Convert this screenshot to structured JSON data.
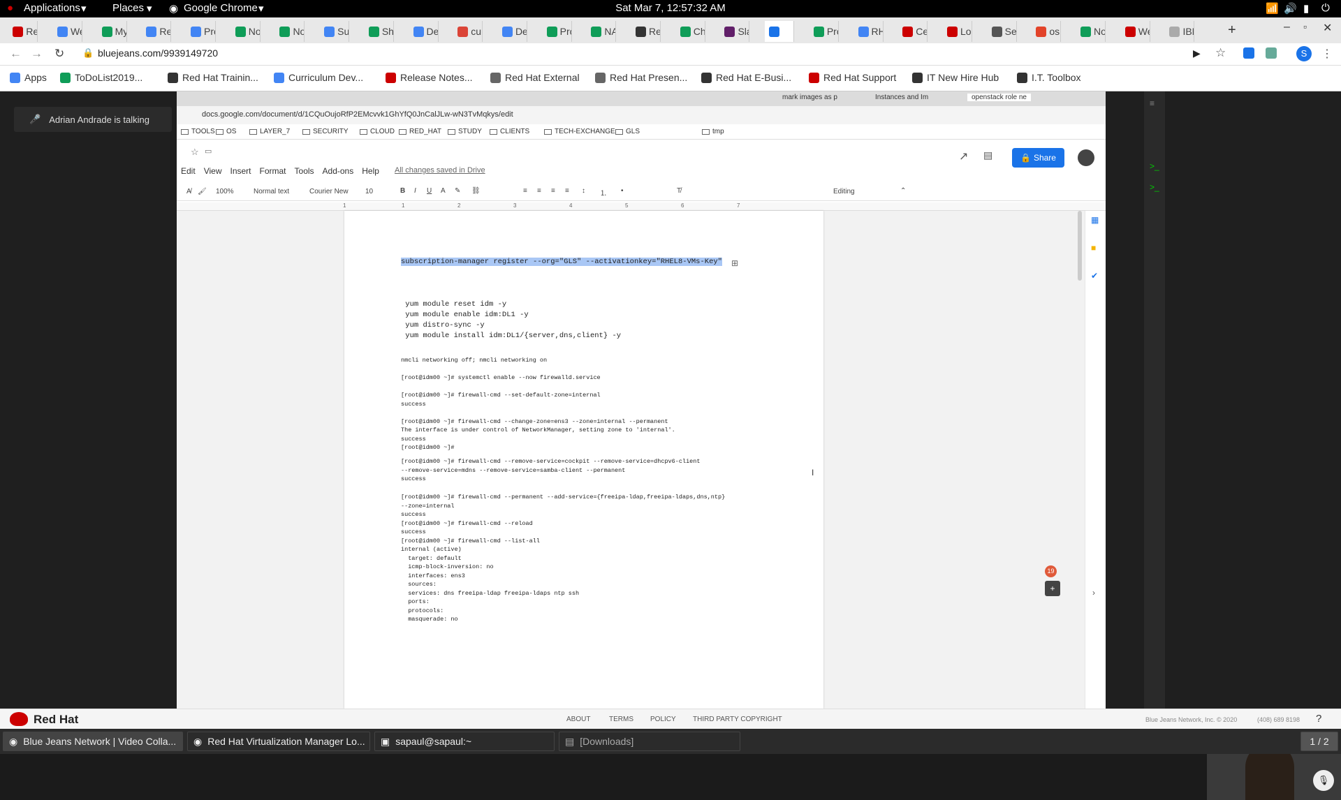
{
  "topbar": {
    "applications": "Applications",
    "places": "Places",
    "app": "Google Chrome",
    "clock": "Sat Mar  7, 12:57:32 AM"
  },
  "chrome": {
    "tabs": [
      {
        "label": "Red",
        "color": "#cc0000"
      },
      {
        "label": "We",
        "color": "#4285f4"
      },
      {
        "label": "My",
        "color": "#0f9d58"
      },
      {
        "label": "Red",
        "color": "#4285f4"
      },
      {
        "label": "Proj",
        "color": "#4285f4"
      },
      {
        "label": "Nov",
        "color": "#0f9d58"
      },
      {
        "label": "Nov",
        "color": "#0f9d58"
      },
      {
        "label": "Sup",
        "color": "#4285f4"
      },
      {
        "label": "Sha",
        "color": "#0f9d58"
      },
      {
        "label": "Dep",
        "color": "#4285f4"
      },
      {
        "label": "curi",
        "color": "#db4437"
      },
      {
        "label": "Dep",
        "color": "#4285f4"
      },
      {
        "label": "Proj",
        "color": "#0f9d58"
      },
      {
        "label": "NA",
        "color": "#0f9d58"
      },
      {
        "label": "Red",
        "color": "#333333"
      },
      {
        "label": "Cha",
        "color": "#0f9d58"
      },
      {
        "label": "Slac",
        "color": "#611f69"
      },
      {
        "label": "",
        "color": "#1a73e8"
      },
      {
        "label": "Proj",
        "color": "#0f9d58"
      },
      {
        "label": "RH",
        "color": "#4285f4"
      },
      {
        "label": "Cep",
        "color": "#cc0000"
      },
      {
        "label": "Log",
        "color": "#cc0000"
      },
      {
        "label": "Sett",
        "color": "#555555"
      },
      {
        "label": "osp",
        "color": "#e24329"
      },
      {
        "label": "Nov",
        "color": "#0f9d58"
      },
      {
        "label": "We",
        "color": "#cc0000"
      },
      {
        "label": "IBM",
        "color": "#aaaaaa"
      }
    ],
    "url": "bluejeans.com/9939149720",
    "bookmarks": [
      {
        "label": "Apps"
      },
      {
        "label": "ToDoList2019..."
      },
      {
        "label": "Red Hat Trainin..."
      },
      {
        "label": "Curriculum Dev..."
      },
      {
        "label": "Release Notes..."
      },
      {
        "label": "Red Hat External"
      },
      {
        "label": "Red Hat Presen..."
      },
      {
        "label": "Red Hat E-Busi..."
      },
      {
        "label": "Red Hat Support"
      },
      {
        "label": "IT New Hire Hub"
      },
      {
        "label": "I.T. Toolbox"
      }
    ]
  },
  "bluejeans": {
    "talking": "Adrian Andrade is talking",
    "badge": "19"
  },
  "shared": {
    "tabs": [
      "mark images as p",
      "Instances and Im",
      "openstack role ne"
    ],
    "url": "docs.google.com/document/d/1CQuOujoRfP2EMcvvk1GhYfQ0JnCalJLw-wN3TvMqkys/edit",
    "bookmarks": [
      "TOOLS",
      "OS",
      "LAYER_7",
      "SECURITY",
      "CLOUD",
      "RED_HAT",
      "STUDY",
      "CLIENTS",
      "TECH-EXCHANGE",
      "GLS",
      "tmp"
    ],
    "menu": [
      "Edit",
      "View",
      "Insert",
      "Format",
      "Tools",
      "Add-ons",
      "Help"
    ],
    "saved": "All changes saved in Drive",
    "share": "Share",
    "zoom": "100%",
    "style": "Normal text",
    "font": "Courier New",
    "size": "10",
    "mode": "Editing",
    "ruler": [
      "1",
      "1",
      "2",
      "3",
      "4",
      "5",
      "6",
      "7"
    ],
    "code": {
      "highlight": "subscription-manager register --org=\"GLS\" --activationkey=\"RHEL8-VMs-Key\"",
      "block1": " yum module reset idm -y\n yum module enable idm:DL1 -y\n yum distro-sync -y\n yum module install idm:DL1/{server,dns,client} -y",
      "block2": "nmcli networking off; nmcli networking on\n\n[root@idm00 ~]# systemctl enable --now firewalld.service\n\n[root@idm00 ~]# firewall-cmd --set-default-zone=internal\nsuccess\n\n[root@idm00 ~]# firewall-cmd --change-zone=ens3 --zone=internal --permanent\nThe interface is under control of NetworkManager, setting zone to 'internal'.\nsuccess\n[root@idm00 ~]#",
      "block3": "[root@idm00 ~]# firewall-cmd --remove-service=cockpit --remove-service=dhcpv6-client\n--remove-service=mdns --remove-service=samba-client --permanent\nsuccess",
      "block4": "[root@idm00 ~]# firewall-cmd --permanent --add-service={freeipa-ldap,freeipa-ldaps,dns,ntp}\n--zone=internal\nsuccess\n[root@idm00 ~]# firewall-cmd --reload\nsuccess\n[root@idm00 ~]# firewall-cmd --list-all\ninternal (active)\n  target: default\n  icmp-block-inversion: no\n  interfaces: ens3\n  sources:\n  services: dns freeipa-ldap freeipa-ldaps ntp ssh\n  ports:\n  protocols:\n  masquerade: no"
    }
  },
  "footer": {
    "brand": "Red Hat",
    "links": [
      "ABOUT",
      "TERMS",
      "POLICY",
      "THIRD PARTY COPYRIGHT"
    ],
    "copyright": "Blue Jeans Network, Inc. © 2020",
    "phone": "(408) 689 8198"
  },
  "taskbar": {
    "items": [
      "Blue Jeans Network | Video Colla...",
      "Red Hat Virtualization Manager Lo...",
      "sapaul@sapaul:~",
      "[Downloads]"
    ],
    "pager": "1 / 2"
  }
}
